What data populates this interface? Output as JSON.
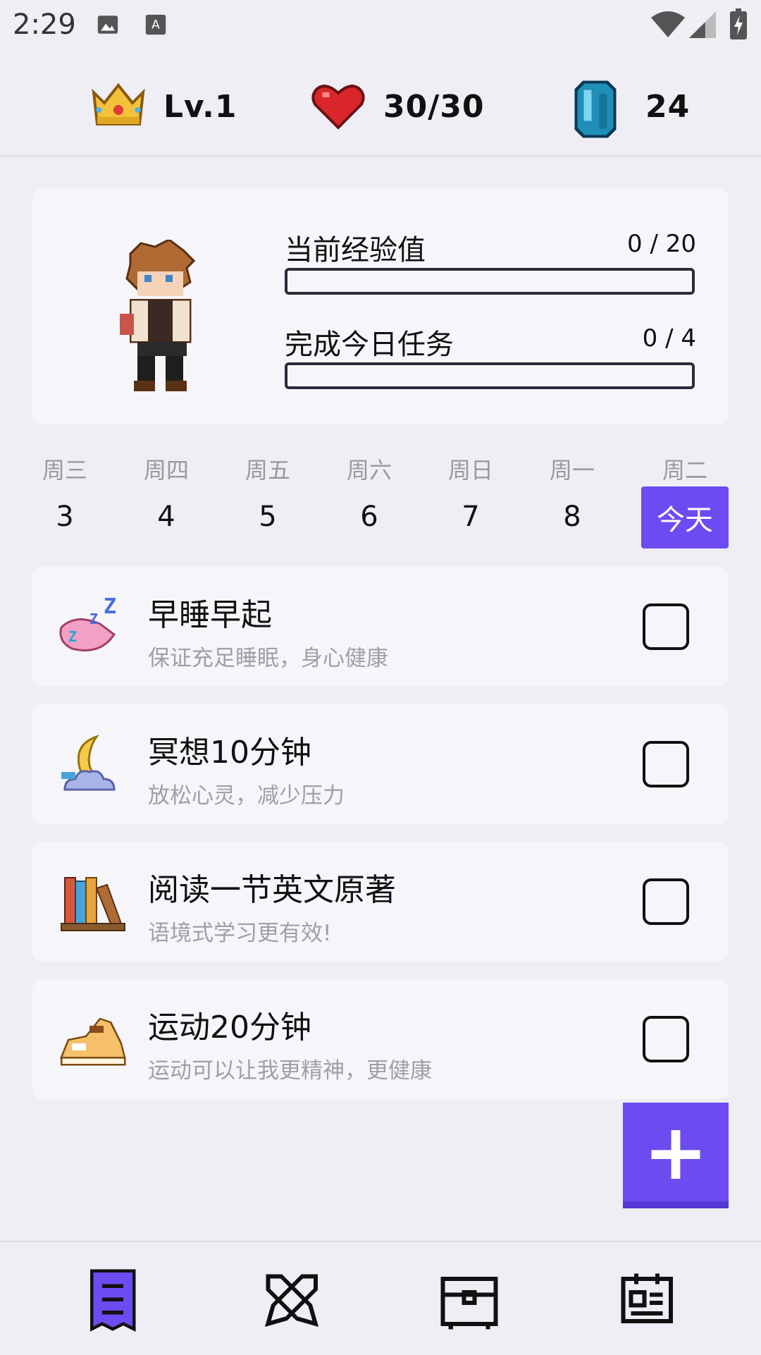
{
  "status_bar": {
    "time": "2:29"
  },
  "stats": {
    "level": "Lv.1",
    "health": "30/30",
    "gems": "24"
  },
  "profile": {
    "exp_label": "当前经验值",
    "exp_count": "0 / 20",
    "exp_progress": 0,
    "task_label": "完成今日任务",
    "task_count": "0 / 4",
    "task_progress": 0
  },
  "week": {
    "days": [
      {
        "name": "周三",
        "num": "3"
      },
      {
        "name": "周四",
        "num": "4"
      },
      {
        "name": "周五",
        "num": "5"
      },
      {
        "name": "周六",
        "num": "6"
      },
      {
        "name": "周日",
        "num": "7"
      },
      {
        "name": "周一",
        "num": "8"
      },
      {
        "name": "周二",
        "num": "今天"
      }
    ]
  },
  "tasks": [
    {
      "title": "早睡早起",
      "subtitle": "保证充足睡眠，身心健康",
      "icon": "sleep-pillow-icon",
      "checked": false
    },
    {
      "title": "冥想10分钟",
      "subtitle": "放松心灵，减少压力",
      "icon": "moon-cloud-icon",
      "checked": false
    },
    {
      "title": "阅读一节英文原著",
      "subtitle": "语境式学习更有效!",
      "icon": "bookshelf-icon",
      "checked": false
    },
    {
      "title": "运动20分钟",
      "subtitle": "运动可以让我更精神，更健康",
      "icon": "sneaker-icon",
      "checked": false
    }
  ],
  "fab": {
    "label": "+"
  },
  "colors": {
    "accent": "#6c4cf0",
    "background": "#efeef4",
    "card": "#f6f5fa"
  }
}
